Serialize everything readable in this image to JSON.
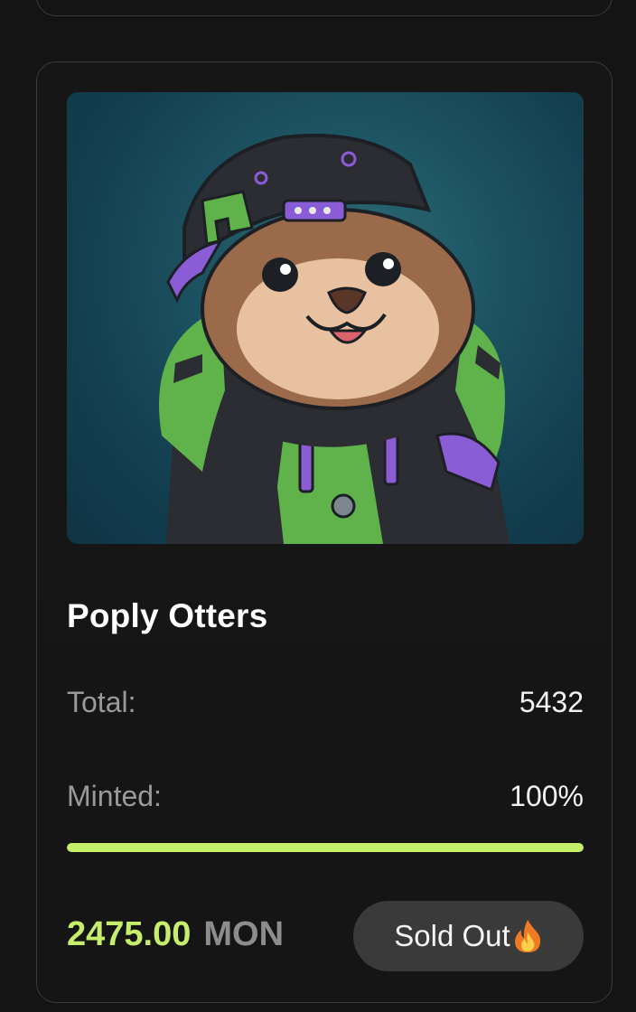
{
  "collection": {
    "name": "Poply Otters",
    "image_alt": "Poply Otters NFT artwork",
    "stats": {
      "total_label": "Total:",
      "total_value": "5432",
      "minted_label": "Minted:",
      "minted_value": "100%",
      "minted_progress": 1.0
    },
    "price": {
      "amount": "2475.00",
      "currency": "MON"
    },
    "status_button": {
      "label": "Sold Out",
      "icon": "fire-icon"
    }
  },
  "colors": {
    "accent": "#c6ee6a",
    "background": "#141414",
    "button_bg": "#3a3a3a",
    "muted_text": "#9a9a9a"
  }
}
